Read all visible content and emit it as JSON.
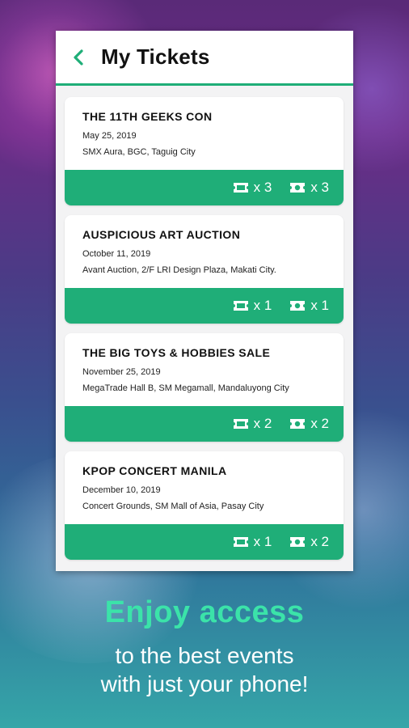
{
  "header": {
    "title": "My Tickets"
  },
  "tickets": [
    {
      "name": "THE 11TH GEEKS CON",
      "date": "May 25, 2019",
      "venue": "SMX Aura, BGC, Taguig City",
      "ticket_count": "x 3",
      "pass_count": "x 3"
    },
    {
      "name": "AUSPICIOUS ART AUCTION",
      "date": "October 11, 2019",
      "venue": "Avant Auction, 2/F LRI Design Plaza, Makati City.",
      "ticket_count": "x 1",
      "pass_count": "x 1"
    },
    {
      "name": "THE BIG TOYS & HOBBIES SALE",
      "date": "November 25, 2019",
      "venue": "MegaTrade Hall B, SM Megamall, Mandaluyong City",
      "ticket_count": "x 2",
      "pass_count": "x 2"
    },
    {
      "name": "KPOP CONCERT MANILA",
      "date": "December 10, 2019",
      "venue": "Concert Grounds, SM Mall of Asia, Pasay City",
      "ticket_count": "x 1",
      "pass_count": "x 2"
    }
  ],
  "promo": {
    "title": "Enjoy access",
    "line1": "to the best events",
    "line2": "with just your phone!"
  },
  "icons": {
    "back": "chevron-left-icon",
    "ticket": "ticket-icon",
    "pass": "pass-icon"
  },
  "colors": {
    "accent": "#1fae78",
    "promo_title": "#3be3a9"
  }
}
